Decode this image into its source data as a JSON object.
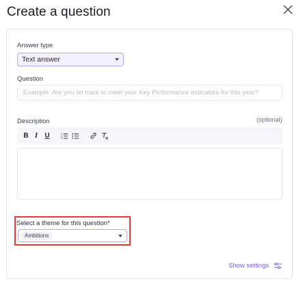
{
  "dialog": {
    "title": "Create a question",
    "close_icon": "close-icon"
  },
  "form": {
    "answer_type": {
      "label": "Answer type",
      "value": "Text answer"
    },
    "question": {
      "label": "Question",
      "placeholder": "Example: Are you on track to meet your Key Performance Indicators for this year?",
      "value": ""
    },
    "description": {
      "label": "Description",
      "optional": "(optional)",
      "toolbar": {
        "bold": "B",
        "italic": "I",
        "underline": "U",
        "icons": [
          "ordered-list-icon",
          "bullet-list-icon",
          "link-icon",
          "clear-format-icon"
        ]
      },
      "value": ""
    },
    "theme": {
      "label": "Select a theme for this question*",
      "value": "Ambitions"
    },
    "show_settings": "Show settings"
  },
  "colors": {
    "accent": "#7e58d6",
    "select_border": "#b8a4ec",
    "select_bg": "#f4f0fd",
    "highlight": "#e53935"
  }
}
